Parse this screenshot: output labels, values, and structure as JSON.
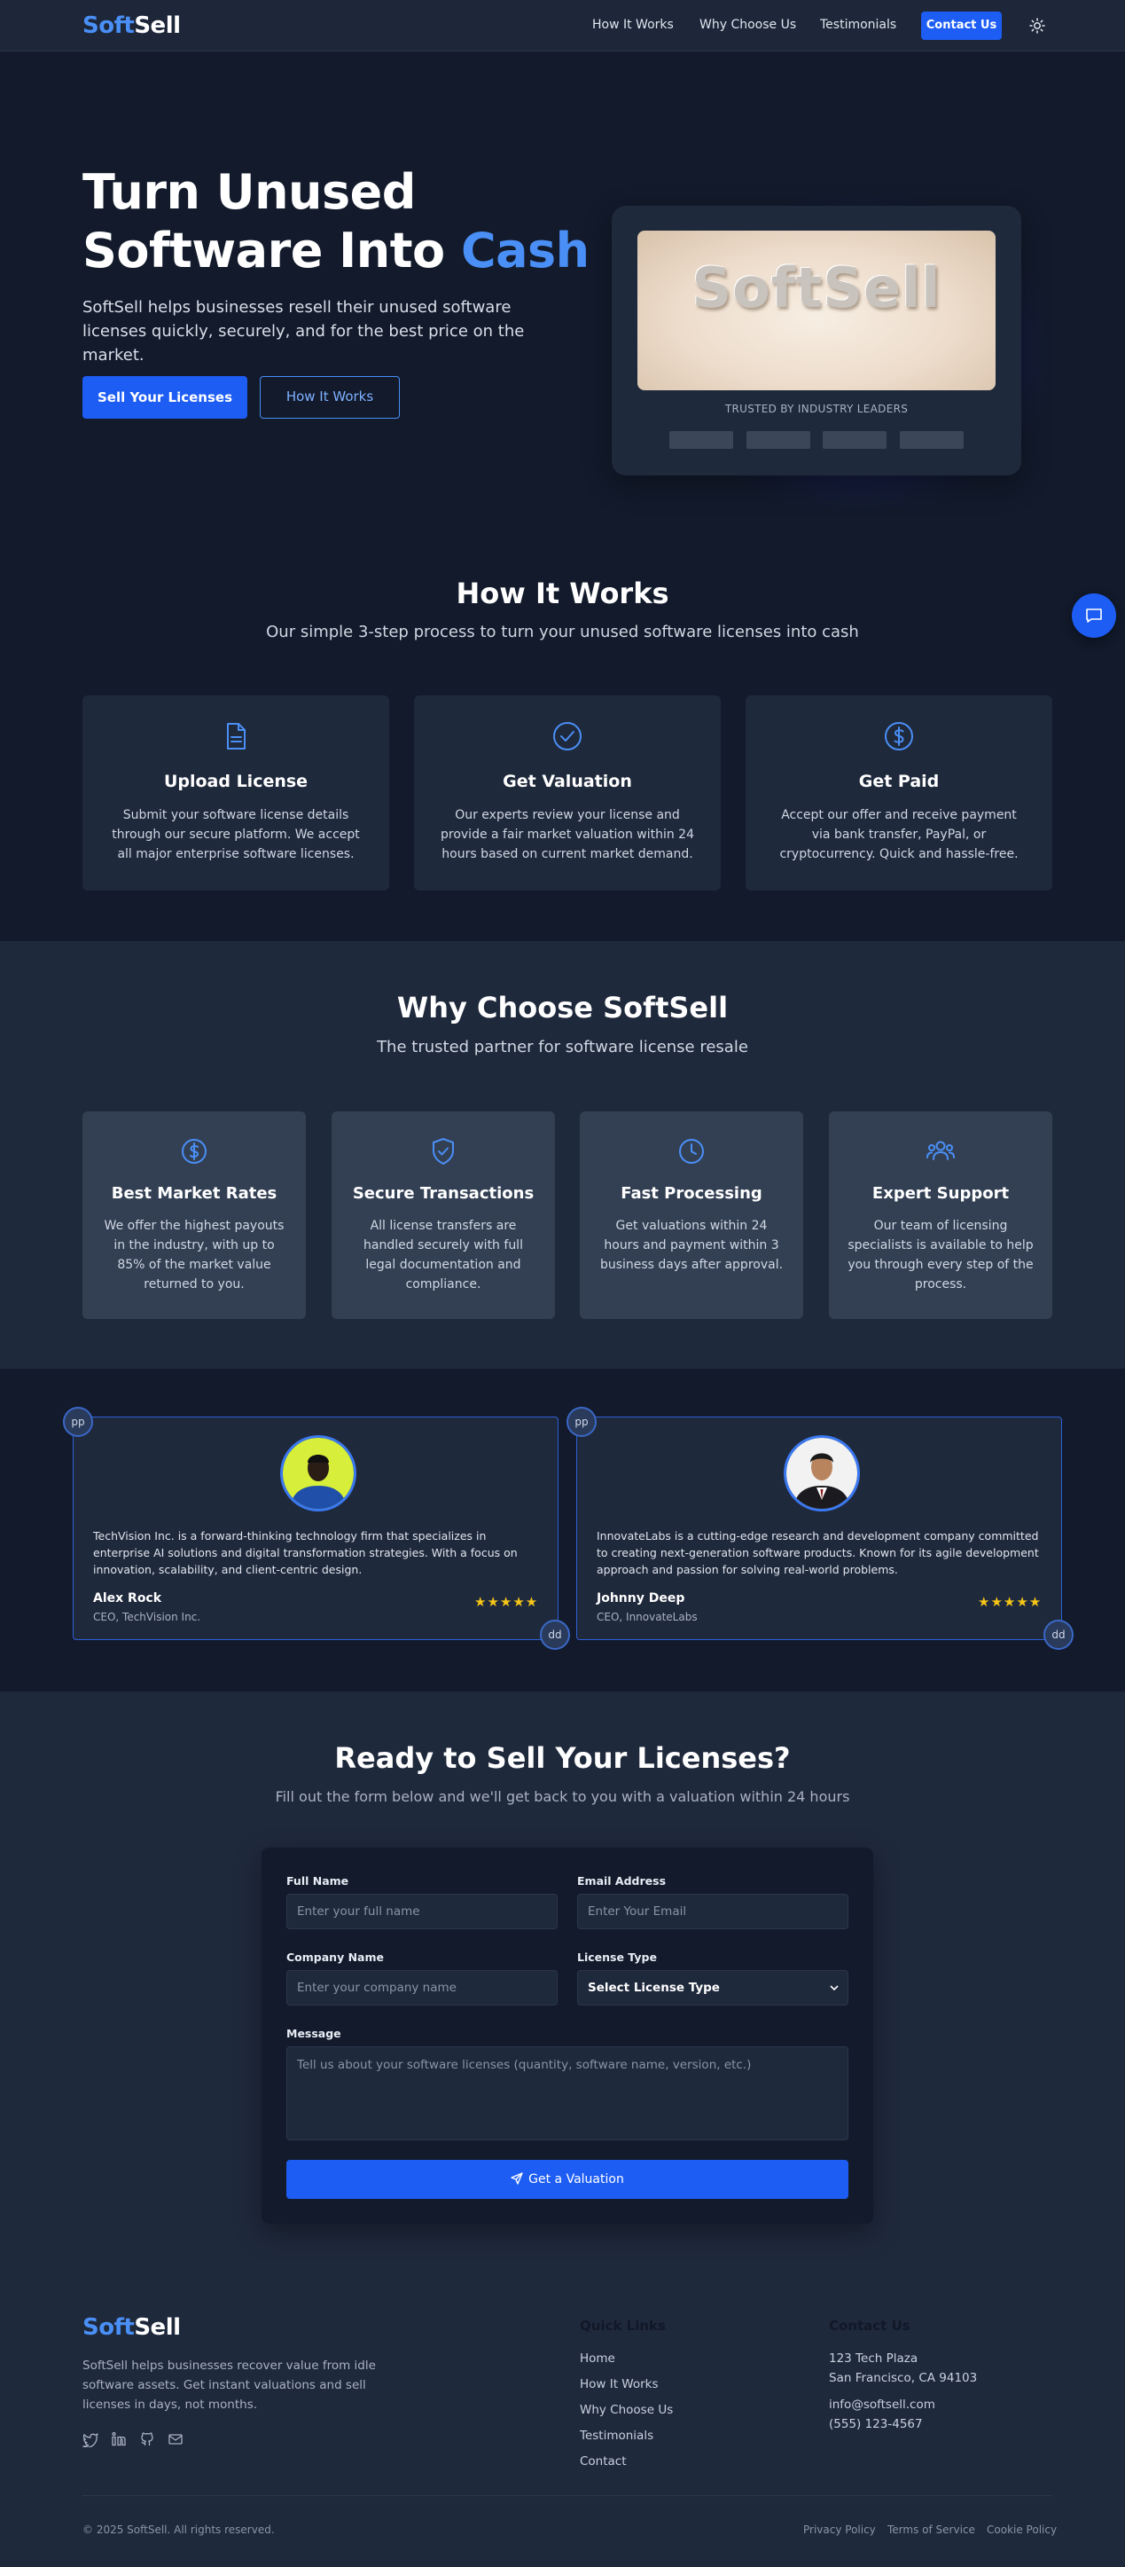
{
  "nav": {
    "logo_a": "Soft",
    "logo_b": "Sell",
    "links": [
      "How It Works",
      "Why Choose Us",
      "Testimonials"
    ],
    "contact": "Contact Us",
    "theme_icon": "sun-icon"
  },
  "hero": {
    "title_line1": "Turn Unused",
    "title_line2a": "Software Into ",
    "title_line2b": "Cash",
    "subtitle": "SoftSell helps businesses resell their unused software licenses quickly, securely, and for the best price on the market.",
    "primary_button": "Sell Your Licenses",
    "secondary_button": "How It Works",
    "image_word": "SoftSell",
    "trusted": "TRUSTED BY INDUSTRY LEADERS"
  },
  "how": {
    "title": "How It Works",
    "subtitle": "Our simple 3-step process to turn your unused software licenses into cash",
    "steps": [
      {
        "icon": "document-icon",
        "title": "Upload License",
        "text": "Submit your software license details through our secure platform. We accept all major enterprise software licenses."
      },
      {
        "icon": "check-circle-icon",
        "title": "Get Valuation",
        "text": "Our experts review your license and provide a fair market valuation within 24 hours based on current market demand."
      },
      {
        "icon": "dollar-icon",
        "title": "Get Paid",
        "text": "Accept our offer and receive payment via bank transfer, PayPal, or cryptocurrency. Quick and hassle-free."
      }
    ]
  },
  "why": {
    "title": "Why Choose SoftSell",
    "subtitle": "The trusted partner for software license resale",
    "features": [
      {
        "icon": "dollar-icon",
        "title": "Best Market Rates",
        "text": "We offer the highest payouts in the industry, with up to 85% of the market value returned to you."
      },
      {
        "icon": "shield-check-icon",
        "title": "Secure Transactions",
        "text": "All license transfers are handled securely with full legal documentation and compliance."
      },
      {
        "icon": "clock-icon",
        "title": "Fast Processing",
        "text": "Get valuations within 24 hours and payment within 3 business days after approval."
      },
      {
        "icon": "users-icon",
        "title": "Expert Support",
        "text": "Our team of licensing specialists is available to help you through every step of the process."
      }
    ]
  },
  "testimonials": [
    {
      "text": "TechVision Inc. is a forward-thinking technology firm that specializes in enterprise AI solutions and digital transformation strategies. With a focus on innovation, scalability, and client-centric design.",
      "name": "Alex Rock",
      "role": "CEO, TechVision Inc.",
      "stars": "★★★★★",
      "badge_top": "pp",
      "badge_bottom": "dd"
    },
    {
      "text": "InnovateLabs is a cutting-edge research and development company committed to creating next-generation software products. Known for its agile development approach and passion for solving real-world problems.",
      "name": "Johnny Deep",
      "role": "CEO, InnovateLabs",
      "stars": "★★★★★",
      "badge_top": "pp",
      "badge_bottom": "dd"
    }
  ],
  "ready": {
    "title": "Ready to Sell Your Licenses?",
    "subtitle": "Fill out the form below and we'll get back to you with a valuation within 24 hours",
    "form": {
      "full_name_label": "Full Name",
      "full_name_placeholder": "Enter your full name",
      "email_label": "Email Address",
      "email_placeholder": "Enter Your Email",
      "company_label": "Company Name",
      "company_placeholder": "Enter your company name",
      "license_label": "License Type",
      "license_value": "Select License Type",
      "message_label": "Message",
      "message_placeholder": "Tell us about your software licenses (quantity, software name, version, etc.)",
      "submit": "Get a Valuation"
    }
  },
  "footer": {
    "logo_a": "Soft",
    "logo_b": "Sell",
    "description": "SoftSell helps businesses recover value from idle software assets. Get instant valuations and sell licenses in days, not months.",
    "quick_links_title": "Quick Links",
    "quick_links": [
      "Home",
      "How It Works",
      "Why Choose Us",
      "Testimonials",
      "Contact"
    ],
    "contact_title": "Contact Us",
    "address1": "123 Tech Plaza",
    "address2": "San Francisco, CA 94103",
    "email": "info@softsell.com",
    "phone": "(555) 123-4567",
    "copyright": "© 2025 SoftSell. All rights reserved.",
    "legal": [
      "Privacy Policy",
      "Terms of Service",
      "Cookie Policy"
    ]
  },
  "colors": {
    "accent": "#1d5df4",
    "brand_blue": "#4a8ff6",
    "bg_dark": "#121a2b",
    "bg_panel": "#1f293c",
    "star": "#f5c518"
  }
}
